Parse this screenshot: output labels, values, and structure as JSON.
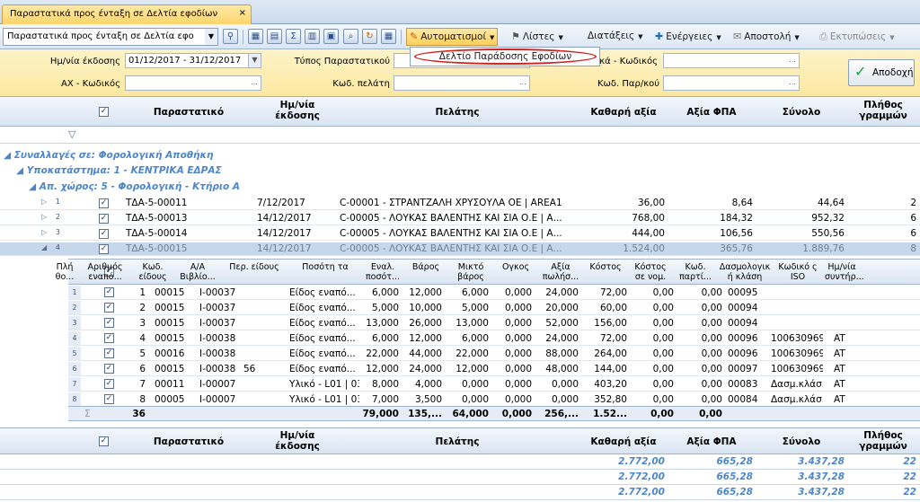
{
  "tab": {
    "title": "Παραστατικά προς ένταξη σε Δελτία εφοδίων"
  },
  "toolbar": {
    "view_combo": "Παραστατικά προς ένταξη σε Δελτία εφο",
    "automations": "Αυτοματισμοί",
    "lists": "Λίστες",
    "arrangements": "Διατάξεις",
    "actions": "Ενέργειες",
    "send": "Αποστολή",
    "prints": "Εκτυπώσεις"
  },
  "menu": {
    "item": "Δελτίο Παράδοσης Εφοδίων"
  },
  "filter": {
    "date_label": "Ημ/νία έκδοσης",
    "date_value": "01/12/2017 - 31/12/2017",
    "doc_type_label": "Τύπος Παραστατικού",
    "species_label": "Είδη/υλικά - Κωδικός",
    "ax_label": "ΑΧ - Κωδικός",
    "customer_label": "Κωδ. πελάτη",
    "carrier_label": "Κωδ. Παρ/κού",
    "accept": "Αποδοχή"
  },
  "grid": {
    "headers": {
      "doc": "Παραστατικό",
      "date": "Ημ/νία έκδοσης",
      "customer": "Πελάτης",
      "net": "Καθαρή αξία",
      "vat": "Αξία ΦΠΑ",
      "total": "Σύνολο",
      "lines": "Πλήθος γραμμών"
    },
    "groups": [
      "Συναλλαγές σε:  Φορολογική Αποθήκη",
      "Υποκατάστημα:  1 - ΚΕΝΤΡΙΚΑ ΕΔΡΑΣ",
      "Απ. χώρος:  5 - Φορολογική - Κτήριο Α"
    ],
    "rows": [
      {
        "n": "1",
        "doc": "ΤΔΑ-5-00011",
        "date": "7/12/2017",
        "customer": "C-00001 - ΣΤΡΑΝΤΖΑΛΗ ΧΡΥΣΟΥΛΑ  ΟΕ      | AREA1",
        "net": "36,00",
        "vat": "8,64",
        "total": "44,64",
        "lines": "2"
      },
      {
        "n": "2",
        "doc": "ΤΔΑ-5-00013",
        "date": "14/12/2017",
        "customer": "C-00005 - ΛΟΥΚΑΣ ΒΑΛΕΝΤΗΣ ΚΑΙ ΣΙΑ Ο.Ε               | Α...",
        "net": "768,00",
        "vat": "184,32",
        "total": "952,32",
        "lines": "6"
      },
      {
        "n": "3",
        "doc": "ΤΔΑ-5-00014",
        "date": "14/12/2017",
        "customer": "C-00005 - ΛΟΥΚΑΣ ΒΑΛΕΝΤΗΣ ΚΑΙ ΣΙΑ Ο.Ε               | Α...",
        "net": "444,00",
        "vat": "106,56",
        "total": "550,56",
        "lines": "6"
      },
      {
        "n": "4",
        "doc": "ΤΔΑ-5-00015",
        "date": "14/12/2017",
        "customer": "C-00005 - ΛΟΥΚΑΣ ΒΑΛΕΝΤΗΣ ΚΑΙ ΣΙΑ Ο.Ε               | Α...",
        "net": "1.524,00",
        "vat": "365,76",
        "total": "1.889,76",
        "lines": "8"
      }
    ]
  },
  "subgrid": {
    "headers": [
      "Πλή θο...",
      "Αριθμός εναπό...",
      "Κωδ. είδους",
      "Α/Α Βιβλίο...",
      "Περ. είδους",
      "Ποσότη τα",
      "Εναλ. ποσότ...",
      "Βάρος",
      "Μικτό βάρος",
      "Ογκος",
      "Αξία πωλήσ...",
      "Κόστος",
      "Κόστος σε νομ.",
      "Κωδ. παρτί...",
      "Δασμολογικ ή κλάση",
      "Κωδικό ς ISO",
      "Ημ/νία συντήρ..."
    ],
    "rows": [
      {
        "i": "1",
        "q": "1",
        "dep": "00015",
        "code": "I-00037",
        "aa": "",
        "desc": "Είδος εναπό...",
        "qty": "6,000",
        "alt": "12,000",
        "w": "6,000",
        "gw": "0,000",
        "vol": "24,000",
        "val": "72,00",
        "cost": "0,00",
        "costn": "0,00",
        "lot": "00095",
        "tariff": "",
        "iso": ""
      },
      {
        "i": "2",
        "q": "2",
        "dep": "00015",
        "code": "I-00037",
        "aa": "",
        "desc": "Είδος εναπό...",
        "qty": "5,000",
        "alt": "10,000",
        "w": "5,000",
        "gw": "0,000",
        "vol": "20,000",
        "val": "60,00",
        "cost": "0,00",
        "costn": "0,00",
        "lot": "00094",
        "tariff": "",
        "iso": ""
      },
      {
        "i": "3",
        "q": "3",
        "dep": "00015",
        "code": "I-00037",
        "aa": "",
        "desc": "Είδος εναπό...",
        "qty": "13,000",
        "alt": "26,000",
        "w": "13,000",
        "gw": "0,000",
        "vol": "52,000",
        "val": "156,00",
        "cost": "0,00",
        "costn": "0,00",
        "lot": "00094",
        "tariff": "",
        "iso": ""
      },
      {
        "i": "4",
        "q": "4",
        "dep": "00015",
        "code": "I-00038",
        "aa": "",
        "desc": "Είδος εναπό...",
        "qty": "6,000",
        "alt": "12,000",
        "w": "6,000",
        "gw": "0,000",
        "vol": "24,000",
        "val": "72,00",
        "cost": "0,00",
        "costn": "0,00",
        "lot": "00096",
        "tariff": "100630969...",
        "iso": "AT"
      },
      {
        "i": "5",
        "q": "5",
        "dep": "00016",
        "code": "I-00038",
        "aa": "",
        "desc": "Είδος εναπό...",
        "qty": "22,000",
        "alt": "44,000",
        "w": "22,000",
        "gw": "0,000",
        "vol": "88,000",
        "val": "264,00",
        "cost": "0,00",
        "costn": "0,00",
        "lot": "00096",
        "tariff": "100630969...",
        "iso": "AT"
      },
      {
        "i": "6",
        "q": "6",
        "dep": "00015",
        "code": "I-00038",
        "aa": "56",
        "desc": "Είδος εναπό...",
        "qty": "12,000",
        "alt": "24,000",
        "w": "12,000",
        "gw": "0,000",
        "vol": "48,000",
        "val": "144,00",
        "cost": "0,00",
        "costn": "0,00",
        "lot": "00097",
        "tariff": "100630969...",
        "iso": "AT"
      },
      {
        "i": "7",
        "q": "7",
        "dep": "00011",
        "code": "I-00007",
        "aa": "",
        "desc": "Υλικό - L01 | 03",
        "qty": "8,000",
        "alt": "4,000",
        "w": "0,000",
        "gw": "0,000",
        "vol": "0,000",
        "val": "403,20",
        "cost": "0,00",
        "costn": "0,00",
        "lot": "00083",
        "tariff": "Δασμ.κλάσ...",
        "iso": "AT"
      },
      {
        "i": "8",
        "q": "8",
        "dep": "00005",
        "code": "I-00007",
        "aa": "",
        "desc": "Υλικό - L01 | 03",
        "qty": "7,000",
        "alt": "3,500",
        "w": "0,000",
        "gw": "0,000",
        "vol": "0,000",
        "val": "352,80",
        "cost": "0,00",
        "costn": "0,00",
        "lot": "00084",
        "tariff": "Δασμ.κλάσ...",
        "iso": "AT"
      }
    ],
    "totals": {
      "sigma": "Σ",
      "q": "36",
      "qty": "79,000",
      "alt": "135,...",
      "w": "64,000",
      "gw": "0,000",
      "vol": "256,...",
      "val": "1.52...",
      "cost": "0,00",
      "costn": "0,00"
    }
  },
  "footer": {
    "totals": [
      {
        "net": "2.772,00",
        "vat": "665,28",
        "total": "3.437,28",
        "lines": "22"
      },
      {
        "net": "2.772,00",
        "vat": "665,28",
        "total": "3.437,28",
        "lines": "22"
      },
      {
        "net": "2.772,00",
        "vat": "665,28",
        "total": "3.437,28",
        "lines": "22"
      }
    ]
  },
  "colors": {
    "accent": "#ffd56b",
    "group_text": "#4d86c8",
    "menu_highlight": "#d2231e"
  }
}
